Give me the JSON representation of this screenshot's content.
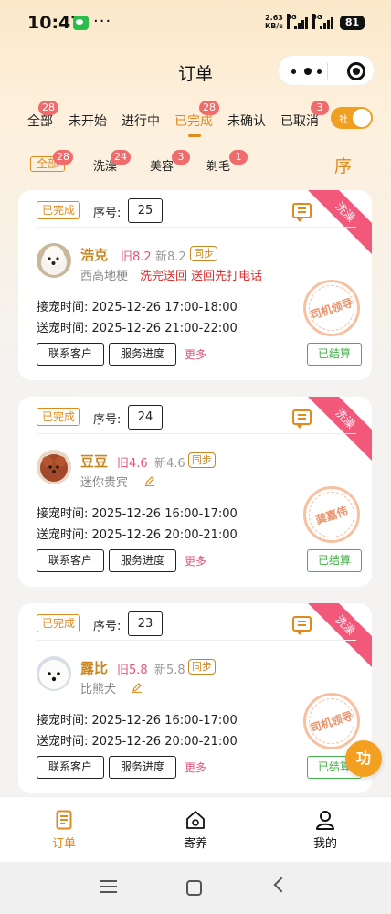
{
  "status_bar": {
    "time": "10:47",
    "dots": "···",
    "net_speed_value": "2.63",
    "net_speed_unit": "KB/s",
    "sig1_gen": "5G",
    "sig2_gen": "5G",
    "battery": "81"
  },
  "header": {
    "title": "订单"
  },
  "status_tabs": [
    {
      "label": "全部",
      "badge": "28"
    },
    {
      "label": "未开始",
      "badge": ""
    },
    {
      "label": "进行中",
      "badge": ""
    },
    {
      "label": "已完成",
      "badge": "28"
    },
    {
      "label": "未确认",
      "badge": ""
    },
    {
      "label": "已取消",
      "badge": "3"
    }
  ],
  "toggle_label": "社",
  "category_tabs": [
    {
      "label": "全部",
      "badge": "28"
    },
    {
      "label": "洗澡",
      "badge": "24"
    },
    {
      "label": "美容",
      "badge": "3"
    },
    {
      "label": "剃毛",
      "badge": "1"
    }
  ],
  "sort_label": "序",
  "orders": [
    {
      "status": "已完成",
      "seq_label": "序号:",
      "seq": "25",
      "service": "洗澡",
      "pet_name": "浩克",
      "old_price": "旧8.2",
      "new_price": "新8.2",
      "sync": "同步",
      "breed": "西高地梗",
      "note": "洗完送回 送回先打电话",
      "pickup": "接宠时间: 2025-12-26 17:00-18:00",
      "dropoff": "送宠时间: 2025-12-26 21:00-22:00",
      "stamp": "司机领导",
      "btn_contact": "联系客户",
      "btn_progress": "服务进度",
      "more": "更多",
      "settled": "已结算"
    },
    {
      "status": "已完成",
      "seq_label": "序号:",
      "seq": "24",
      "service": "洗澡",
      "pet_name": "豆豆",
      "old_price": "旧4.6",
      "new_price": "新4.6",
      "sync": "同步",
      "breed": "迷你贵宾",
      "note": "",
      "pickup": "接宠时间: 2025-12-26 16:00-17:00",
      "dropoff": "送宠时间: 2025-12-26 20:00-21:00",
      "stamp": "龚嘉伟",
      "btn_contact": "联系客户",
      "btn_progress": "服务进度",
      "more": "更多",
      "settled": "已结算"
    },
    {
      "status": "已完成",
      "seq_label": "序号:",
      "seq": "23",
      "service": "洗澡",
      "pet_name": "露比",
      "old_price": "旧5.8",
      "new_price": "新5.8",
      "sync": "同步",
      "breed": "比熊犬",
      "note": "",
      "pickup": "接宠时间: 2025-12-26 16:00-17:00",
      "dropoff": "送宠时间: 2025-12-26 20:00-21:00",
      "stamp": "司机领导",
      "btn_contact": "联系客户",
      "btn_progress": "服务进度",
      "more": "更多",
      "settled": "已结算"
    }
  ],
  "float_button": "功",
  "bottom_nav": [
    {
      "label": "订单",
      "icon": "order-doc-icon"
    },
    {
      "label": "寄养",
      "icon": "home-pet-icon"
    },
    {
      "label": "我的",
      "icon": "user-icon"
    }
  ],
  "colors": {
    "accent": "#e08a1e",
    "ribbon": "#f2587a",
    "settled": "#46b04a",
    "badge": "#f06b6b"
  }
}
